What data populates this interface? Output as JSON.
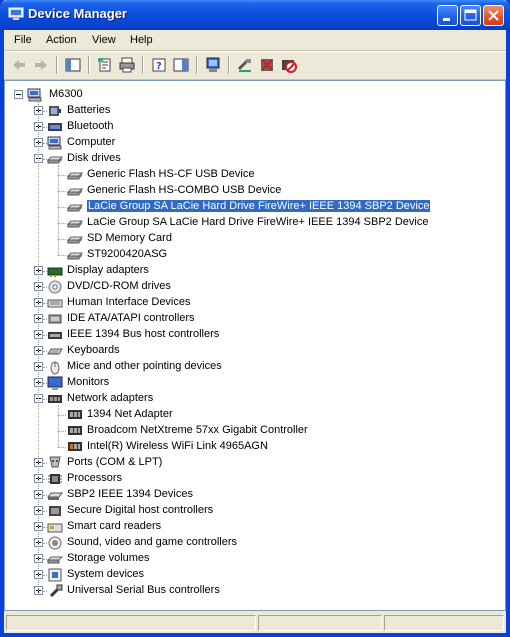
{
  "window": {
    "title": "Device Manager"
  },
  "menu": [
    "File",
    "Action",
    "View",
    "Help"
  ],
  "toolbar": [
    "back-icon",
    "forward-icon",
    "console-tree-icon",
    "properties-icon",
    "print-icon",
    "help-icon",
    "show-hide-icon",
    "scan-hardware-icon",
    "update-driver-icon",
    "uninstall-icon",
    "disable-icon"
  ],
  "tree": {
    "root": "M6300",
    "nodes": [
      {
        "label": "Batteries",
        "expanded": false,
        "icon": "battery-icon"
      },
      {
        "label": "Bluetooth",
        "expanded": false,
        "icon": "bluetooth-icon"
      },
      {
        "label": "Computer",
        "expanded": false,
        "icon": "computer-icon"
      },
      {
        "label": "Disk drives",
        "expanded": true,
        "icon": "disk-drive-icon",
        "children": [
          {
            "label": "Generic Flash HS-CF USB Device",
            "icon": "disk-drive-icon"
          },
          {
            "label": "Generic Flash HS-COMBO USB Device",
            "icon": "disk-drive-icon"
          },
          {
            "label": "LaCie Group SA LaCie Hard Drive FireWire+ IEEE 1394 SBP2 Device",
            "icon": "disk-drive-icon",
            "selected": true
          },
          {
            "label": "LaCie Group SA LaCie Hard Drive FireWire+ IEEE 1394 SBP2 Device",
            "icon": "disk-drive-icon"
          },
          {
            "label": "SD Memory Card",
            "icon": "disk-drive-icon"
          },
          {
            "label": "ST9200420ASG",
            "icon": "disk-drive-icon"
          }
        ]
      },
      {
        "label": "Display adapters",
        "expanded": false,
        "icon": "display-icon"
      },
      {
        "label": "DVD/CD-ROM drives",
        "expanded": false,
        "icon": "dvd-icon"
      },
      {
        "label": "Human Interface Devices",
        "expanded": false,
        "icon": "hid-icon"
      },
      {
        "label": "IDE ATA/ATAPI controllers",
        "expanded": false,
        "icon": "ide-icon"
      },
      {
        "label": "IEEE 1394 Bus host controllers",
        "expanded": false,
        "icon": "ieee1394-icon"
      },
      {
        "label": "Keyboards",
        "expanded": false,
        "icon": "keyboard-icon"
      },
      {
        "label": "Mice and other pointing devices",
        "expanded": false,
        "icon": "mouse-icon"
      },
      {
        "label": "Monitors",
        "expanded": false,
        "icon": "monitor-icon"
      },
      {
        "label": "Network adapters",
        "expanded": true,
        "icon": "network-icon",
        "children": [
          {
            "label": "1394 Net Adapter",
            "icon": "network-card-icon"
          },
          {
            "label": "Broadcom NetXtreme 57xx Gigabit Controller",
            "icon": "network-card-icon"
          },
          {
            "label": "Intel(R) Wireless WiFi Link 4965AGN",
            "icon": "wireless-card-icon"
          }
        ]
      },
      {
        "label": "Ports (COM & LPT)",
        "expanded": false,
        "icon": "ports-icon"
      },
      {
        "label": "Processors",
        "expanded": false,
        "icon": "processor-icon"
      },
      {
        "label": "SBP2 IEEE 1394 Devices",
        "expanded": false,
        "icon": "sbp2-icon"
      },
      {
        "label": "Secure Digital host controllers",
        "expanded": false,
        "icon": "sd-host-icon"
      },
      {
        "label": "Smart card readers",
        "expanded": false,
        "icon": "smart-card-icon"
      },
      {
        "label": "Sound, video and game controllers",
        "expanded": false,
        "icon": "sound-icon"
      },
      {
        "label": "Storage volumes",
        "expanded": false,
        "icon": "storage-volume-icon"
      },
      {
        "label": "System devices",
        "expanded": false,
        "icon": "system-devices-icon"
      },
      {
        "label": "Universal Serial Bus controllers",
        "expanded": false,
        "icon": "usb-icon"
      }
    ]
  }
}
